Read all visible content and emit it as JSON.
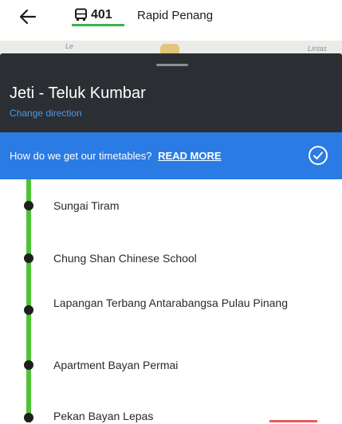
{
  "header": {
    "back_icon": "arrow-left-icon",
    "route_icon": "bus-icon",
    "route_number": "401",
    "operator": "Rapid Penang",
    "accent_color": "#3bb34a"
  },
  "map": {
    "labels": [
      "Le",
      "Lintas"
    ]
  },
  "sheet": {
    "title": "Jeti - Teluk Kumbar",
    "change_direction": "Change direction",
    "background_color": "#2b2e33",
    "link_color": "#4c9be8"
  },
  "banner": {
    "text": "How do we get our timetables?",
    "link": "READ MORE",
    "dismiss_icon": "check-circle-icon",
    "background_color": "#2a7be3"
  },
  "stops": [
    "Sungai Tiram",
    "Chung Shan Chinese School",
    "Lapangan Terbang Antarabangsa Pulau Pinang",
    "Apartment Bayan Permai",
    "Pekan Bayan Lepas"
  ],
  "route_line_color": "#4fc236"
}
